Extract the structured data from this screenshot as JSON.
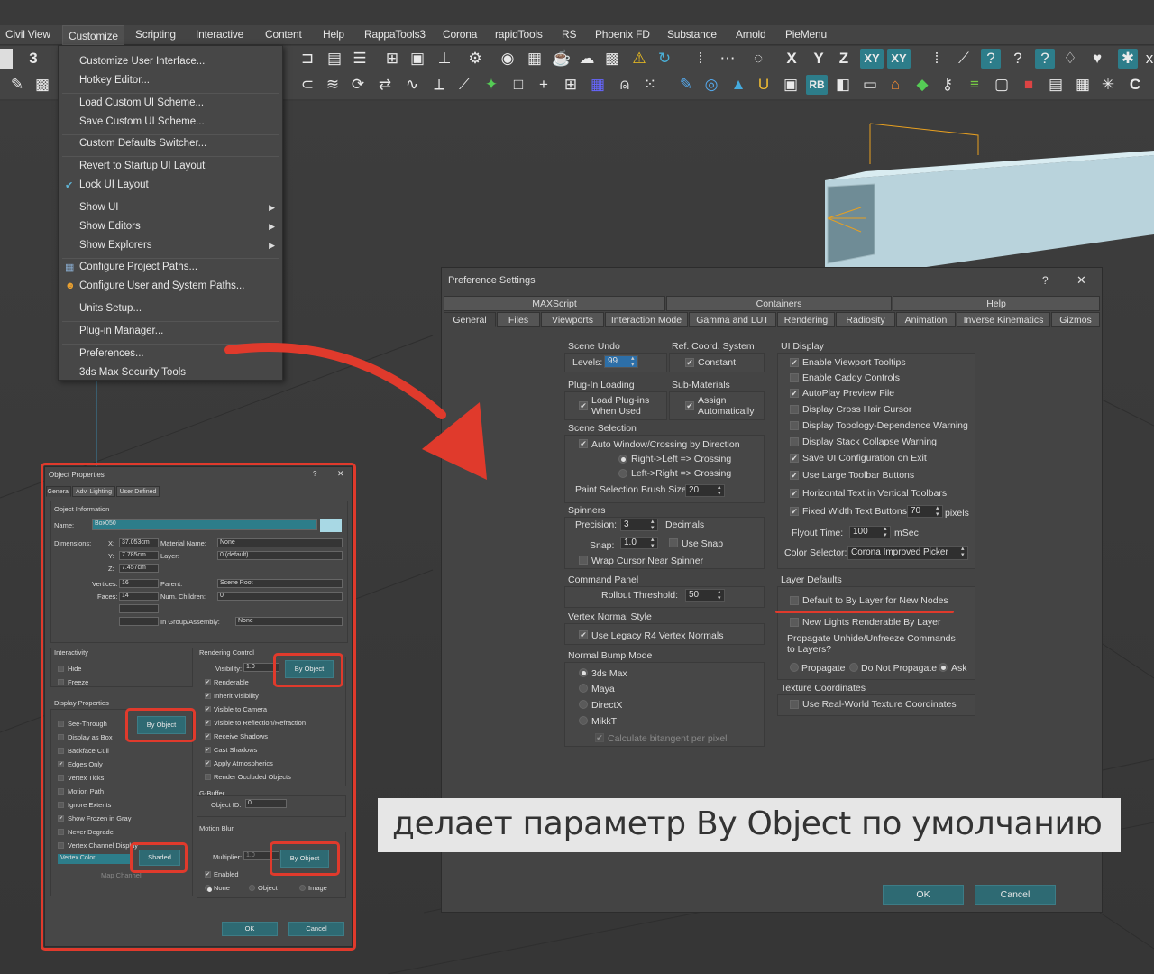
{
  "menubar": {
    "items": [
      "Civil View",
      "Customize",
      "Scripting",
      "Interactive",
      "Content",
      "Help",
      "RappaTools3",
      "Corona",
      "rapidTools",
      "RS",
      "Phoenix FD",
      "Substance",
      "Arnold",
      "PieMenu"
    ],
    "active": "Customize"
  },
  "toolbar": {
    "axis_labels": [
      "X",
      "Y",
      "Z",
      "XY",
      "XY"
    ],
    "rb_label": "RB"
  },
  "customize_menu": {
    "customize_ui": "Customize User Interface...",
    "hotkey_editor": "Hotkey Editor...",
    "load_scheme": "Load Custom UI Scheme...",
    "save_scheme": "Save Custom UI Scheme...",
    "defaults_switcher": "Custom Defaults Switcher...",
    "revert_layout": "Revert to Startup UI Layout",
    "lock_layout": "Lock UI Layout",
    "show_ui": "Show UI",
    "show_editors": "Show Editors",
    "show_explorers": "Show Explorers",
    "project_paths": "Configure Project Paths...",
    "user_system_paths": "Configure User and System Paths...",
    "units_setup": "Units Setup...",
    "plugin_manager": "Plug-in Manager...",
    "preferences": "Preferences...",
    "security_tools": "3ds Max Security Tools"
  },
  "pref": {
    "title": "Preference Settings",
    "help_btn": "?",
    "close_btn": "✕",
    "tabs_top": [
      "MAXScript",
      "Containers",
      "Help"
    ],
    "tabs": [
      "General",
      "Files",
      "Viewports",
      "Interaction Mode",
      "Gamma and LUT",
      "Rendering",
      "Radiosity",
      "Animation",
      "Inverse Kinematics",
      "Gizmos"
    ],
    "scene_undo": "Scene Undo",
    "levels_label": "Levels:",
    "levels_value": "99",
    "ref_coord": "Ref. Coord. System",
    "constant": "Constant",
    "plugin_loading": "Plug-In Loading",
    "load_plugins": "Load Plug-ins",
    "when_used": "When Used",
    "sub_materials": "Sub-Materials",
    "assign": "Assign",
    "automatically": "Automatically",
    "scene_selection": "Scene Selection",
    "auto_window": "Auto Window/Crossing by Direction",
    "right_left": "Right->Left => Crossing",
    "left_right": "Left->Right => Crossing",
    "paint_brush": "Paint Selection Brush Size",
    "paint_value": "20",
    "spinners": "Spinners",
    "precision": "Precision:",
    "precision_value": "3",
    "decimals": "Decimals",
    "snap": "Snap:",
    "snap_value": "1.0",
    "use_snap": "Use Snap",
    "wrap_cursor": "Wrap Cursor Near Spinner",
    "command_panel": "Command Panel",
    "rollout_threshold": "Rollout Threshold:",
    "rollout_value": "50",
    "vertex_normal": "Vertex Normal Style",
    "legacy_normals": "Use Legacy R4 Vertex Normals",
    "normal_bump": "Normal Bump Mode",
    "bump_3dsmax": "3ds Max",
    "bump_maya": "Maya",
    "bump_directx": "DirectX",
    "bump_mikkt": "MikkT",
    "calc_bitangent": "Calculate bitangent per pixel",
    "ui_display": "UI Display",
    "ui_options": [
      "Enable Viewport Tooltips",
      "Enable Caddy Controls",
      "AutoPlay Preview File",
      "Display Cross Hair Cursor",
      "Display Topology-Dependence Warning",
      "Display Stack Collapse Warning",
      "Save UI Configuration on Exit",
      "Use Large Toolbar Buttons",
      "Horizontal Text in Vertical Toolbars"
    ],
    "fixed_width": "Fixed Width Text Buttons:",
    "fixed_value": "70",
    "pixels": "pixels",
    "flyout_time": "Flyout Time:",
    "flyout_value": "100",
    "msec": "mSec",
    "color_selector": "Color Selector:",
    "color_value": "Corona Improved Picker",
    "layer_defaults": "Layer Defaults",
    "default_by_layer": "Default to By Layer for New Nodes",
    "new_lights": "New Lights Renderable By Layer",
    "propagate_q": "Propagate Unhide/Unfreeze Commands",
    "to_layers": "to Layers?",
    "propagate": "Propagate",
    "do_not_propagate": "Do Not Propagate",
    "ask": "Ask",
    "texture_coords": "Texture Coordinates",
    "real_world": "Use Real-World Texture Coordinates",
    "ok": "OK",
    "cancel": "Cancel"
  },
  "objprops": {
    "title": "Object Properties",
    "help_btn": "?",
    "close_btn": "✕",
    "tabs": [
      "General",
      "Adv. Lighting",
      "User Defined"
    ],
    "obj_info": "Object Information",
    "name_label": "Name:",
    "name_value": "Box050",
    "dimensions": "Dimensions:",
    "x": "X:",
    "y": "Y:",
    "z": "Z:",
    "x_val": "37.053cm",
    "y_val": "7.785cm",
    "z_val": "7.457cm",
    "material_name": "Material Name:",
    "material_val": "None",
    "layer": "Layer:",
    "layer_val": "0 (default)",
    "vertices": "Vertices:",
    "vertices_val": "16",
    "faces": "Faces:",
    "faces_val": "14",
    "parent": "Parent:",
    "parent_val": "Scene Root",
    "num_children": "Num. Children:",
    "num_children_val": "0",
    "in_group": "In Group/Assembly:",
    "in_group_val": "None",
    "interactivity": "Interactivity",
    "hide": "Hide",
    "freeze": "Freeze",
    "display_props": "Display Properties",
    "by_object": "By Object",
    "display_opts": [
      "See-Through",
      "Display as Box",
      "Backface Cull",
      "Edges Only",
      "Vertex Ticks",
      "Motion Path",
      "Ignore Extents",
      "Show Frozen in Gray",
      "Never Degrade",
      "Vertex Channel Display"
    ],
    "vertex_color": "Vertex Color",
    "shaded": "Shaded",
    "map_channel": "Map Channel",
    "rendering_control": "Rendering Control",
    "visibility": "Visibility:",
    "visibility_val": "1.0",
    "render_opts": [
      "Renderable",
      "Inherit Visibility",
      "Visible to Camera",
      "Visible to Reflection/Refraction",
      "Receive Shadows",
      "Cast Shadows",
      "Apply Atmospherics",
      "Render Occluded Objects"
    ],
    "gbuffer": "G-Buffer",
    "object_id": "Object ID:",
    "object_id_val": "0",
    "motion_blur": "Motion Blur",
    "multiplier": "Multiplier:",
    "multiplier_val": "1.0",
    "enabled": "Enabled",
    "mb_none": "None",
    "mb_object": "Object",
    "mb_image": "Image",
    "ok": "OK",
    "cancel": "Cancel"
  },
  "caption": "делает параметр By Object по умолчанию"
}
